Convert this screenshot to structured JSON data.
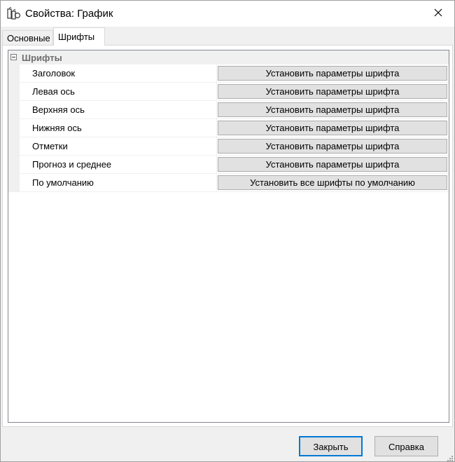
{
  "window": {
    "title": "Свойства: График"
  },
  "tabs": [
    {
      "label": "Основные",
      "active": false
    },
    {
      "label": "Шрифты",
      "active": true
    }
  ],
  "category": {
    "label": "Шрифты",
    "expanded": true
  },
  "properties": [
    {
      "name": "Заголовок",
      "button": "Установить параметры шрифта"
    },
    {
      "name": "Левая ось",
      "button": "Установить параметры шрифта"
    },
    {
      "name": "Верхняя ось",
      "button": "Установить параметры шрифта"
    },
    {
      "name": "Нижняя ось",
      "button": "Установить параметры шрифта"
    },
    {
      "name": "Отметки",
      "button": "Установить параметры шрифта"
    },
    {
      "name": "Прогноз и среднее",
      "button": "Установить параметры шрифта"
    },
    {
      "name": "По умолчанию",
      "button": "Установить все шрифты по умолчанию"
    }
  ],
  "footer": {
    "close_label": "Закрыть",
    "help_label": "Справка"
  },
  "colors": {
    "accent": "#0078d7",
    "button_face": "#e1e1e1",
    "window_bg": "#f0f0f0"
  },
  "icons": {
    "app": "chart-app-icon",
    "close": "close-icon",
    "collapse": "minus-box-icon",
    "grip": "size-grip-icon"
  }
}
